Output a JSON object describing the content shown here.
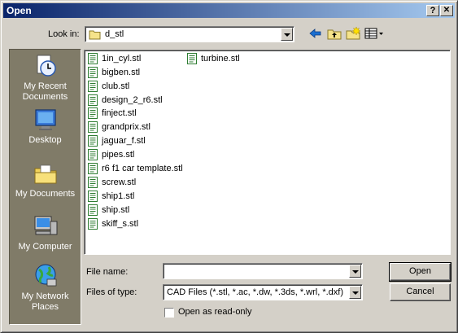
{
  "window": {
    "title": "Open"
  },
  "titlebar": {
    "help_label": "?",
    "close_label": "✕"
  },
  "look_in": {
    "label": "Look in:",
    "value": "d_stl"
  },
  "toolbar": {
    "icons": [
      "back-icon",
      "up-folder-icon",
      "new-folder-icon",
      "view-menu-icon"
    ]
  },
  "places": [
    {
      "label": "My Recent Documents",
      "icon": "recent-documents-icon"
    },
    {
      "label": "Desktop",
      "icon": "desktop-icon"
    },
    {
      "label": "My Documents",
      "icon": "my-documents-icon"
    },
    {
      "label": "My Computer",
      "icon": "my-computer-icon"
    },
    {
      "label": "My Network Places",
      "icon": "network-places-icon"
    }
  ],
  "files": [
    "1in_cyl.stl",
    "bigben.stl",
    "club.stl",
    "design_2_r6.stl",
    "finject.stl",
    "grandprix.stl",
    "jaguar_f.stl",
    "pipes.stl",
    "r6 f1 car template.stl",
    "screw.stl",
    "ship1.stl",
    "ship.stl",
    "skiff_s.stl",
    "turbine.stl"
  ],
  "file_name": {
    "label": "File name:",
    "value": ""
  },
  "file_type": {
    "label": "Files of type:",
    "value": "CAD Files (*.stl, *.ac, *.dw, *.3ds, *.wrl, *.dxf)"
  },
  "readonly": {
    "label": "Open as read-only",
    "checked": false
  },
  "buttons": {
    "open": "Open",
    "cancel": "Cancel"
  }
}
